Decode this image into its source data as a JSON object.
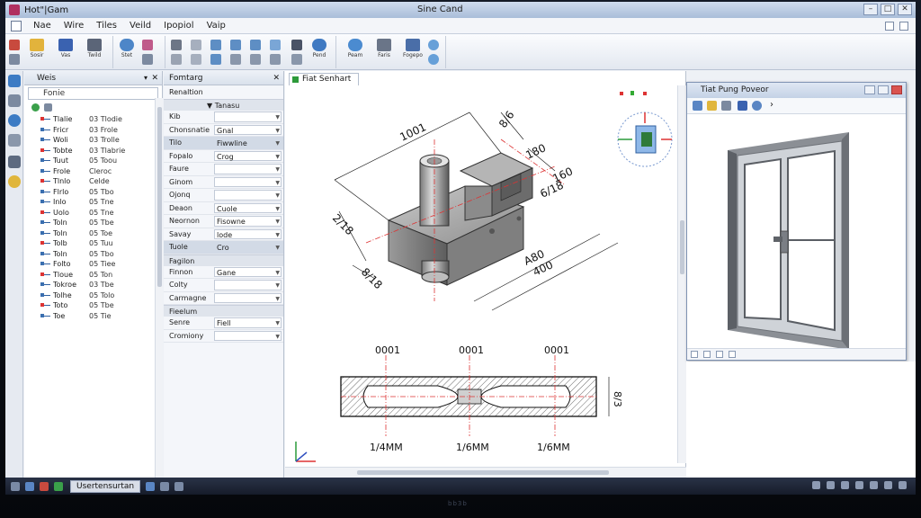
{
  "window": {
    "app_title": "Hot\"|Gam",
    "doc_title": "Sine Cand"
  },
  "menu": [
    "Nae",
    "Wire",
    "Tiles",
    "Veild",
    "Ipopiol",
    "Vaip"
  ],
  "toolbar": {
    "buttons": [
      {
        "label": "Sosir",
        "icon": "folder-icon"
      },
      {
        "label": "Vas",
        "icon": "book-icon"
      },
      {
        "label": "Twild",
        "icon": "pen-icon"
      },
      {
        "label": "Stet",
        "icon": "zoom-icon"
      },
      {
        "label": "Pend",
        "icon": "magnifier-icon"
      },
      {
        "label": "Peam",
        "icon": "globe-icon"
      },
      {
        "label": "Faris",
        "icon": "page-icon"
      },
      {
        "label": "Fogepo",
        "icon": "shield-icon"
      }
    ]
  },
  "tree": {
    "title": "Weis",
    "filter": "Fonie",
    "rows": [
      {
        "name": "Tlalie",
        "value": "03 Tlodie"
      },
      {
        "name": "Fricr",
        "value": "03 Frole"
      },
      {
        "name": "Woli",
        "value": "03 Trolle"
      },
      {
        "name": "Tobte",
        "value": "03 Tlabrie"
      },
      {
        "name": "Tuut",
        "value": "05 Toou"
      },
      {
        "name": "Frole",
        "value": "Cleroc"
      },
      {
        "name": "Tlnlo",
        "value": "Celde"
      },
      {
        "name": "Flrlo",
        "value": "05 Tbo"
      },
      {
        "name": "Inlo",
        "value": "05 Tne"
      },
      {
        "name": "Uolo",
        "value": "05 Tne"
      },
      {
        "name": "Toln",
        "value": "05 Tbe"
      },
      {
        "name": "Toln",
        "value": "05 Toe"
      },
      {
        "name": "Tolb",
        "value": "05 Tuu"
      },
      {
        "name": "Toln",
        "value": "05 Tbo"
      },
      {
        "name": "Folto",
        "value": "05 Tiee"
      },
      {
        "name": "Tloue",
        "value": "05 Ton"
      },
      {
        "name": "Tokroe",
        "value": "03 Tbe"
      },
      {
        "name": "Tolhe",
        "value": "05 Tolo"
      },
      {
        "name": "Toto",
        "value": "05 Tbe"
      },
      {
        "name": "Toe",
        "value": "05 Tie"
      }
    ]
  },
  "properties": {
    "title": "Fomtarg",
    "subtitle": "Renaltion",
    "header_col": "Tanasu",
    "rows": [
      {
        "key": "Kib",
        "value": ""
      },
      {
        "key": "Chonsnatie",
        "value": "Gnal"
      },
      {
        "key": "Tilo",
        "value": "Fiwwline",
        "selected": true
      },
      {
        "key": "Fopalo",
        "value": "Crog"
      },
      {
        "key": "Faure",
        "value": ""
      },
      {
        "key": "Ginom",
        "value": ""
      },
      {
        "key": "Ojonq",
        "value": ""
      },
      {
        "key": "Deaon",
        "value": "Cuole"
      },
      {
        "key": "Neornon",
        "value": "Fisowne"
      },
      {
        "key": "Savay",
        "value": "lode"
      },
      {
        "key": "Tuole",
        "value": "Cro",
        "selected": true
      }
    ],
    "section2": "Fagilon",
    "rows2": [
      {
        "key": "Finnon",
        "value": "Gane"
      },
      {
        "key": "Colty",
        "value": ""
      },
      {
        "key": "Carmagne",
        "value": ""
      }
    ],
    "section3": "Fieelum",
    "rows3": [
      {
        "key": "Senre",
        "value": "Fiell"
      },
      {
        "key": "Cromiony",
        "value": ""
      }
    ]
  },
  "drawing": {
    "tab": "Fiat Senhart",
    "dims_iso": [
      "1001",
      "8/6",
      "180",
      "160",
      "6/18",
      "2/18",
      "8/18",
      "A80",
      "400"
    ],
    "dims_section": [
      "0001",
      "0001",
      "0001",
      "1/4MM",
      "1/6MM",
      "1/6MM",
      "8/3"
    ]
  },
  "preview": {
    "title": "Tiat Pung Poveor"
  },
  "taskbar": {
    "active": "Usertensurtan"
  },
  "brand": "bb3b"
}
